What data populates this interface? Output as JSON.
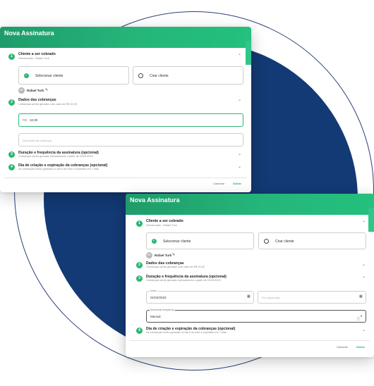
{
  "modal1": {
    "title": "Nova Assinatura",
    "step1": {
      "num": "1",
      "title": "Cliente a ser cobrado",
      "subtitle": "Selecionado - Rafael Turk",
      "select_label": "Selecionar cliente",
      "create_label": "Criar cliente",
      "avatar_initials": "RT",
      "user_name": "Rafael Turk"
    },
    "step2": {
      "num": "2",
      "title": "Dados das cobranças",
      "subtitle": "Cobranças serão geradas com valor de R$ 10,00",
      "value_prefix": "R$",
      "value": "10,00",
      "description_placeholder": "Descrição da cobrança"
    },
    "step3": {
      "num": "3",
      "title": "Duração e frequência da assinatura (opcional)",
      "subtitle": "Cobranças serão geradas mensalmente a partir de 01/02/2023"
    },
    "step4": {
      "num": "4",
      "title": "Dia de criação e expiração da cobranças (opcional)",
      "subtitle": "As cobranças serão geradas no dia 6 do mês e expirarão em 7 dias"
    },
    "cancel_label": "Cancelar",
    "save_label": "Salvar"
  },
  "modal2": {
    "title": "Nova Assinatura",
    "step1": {
      "num": "1",
      "title": "Cliente a ser cobrado",
      "subtitle": "Selecionado - Rafael Turk",
      "select_label": "Selecionar cliente",
      "create_label": "Criar cliente",
      "avatar_initials": "RT",
      "user_name": "Rafael Turk"
    },
    "step2": {
      "num": "2",
      "title": "Dados das cobranças",
      "subtitle": "Cobranças serão geradas com valor de R$ 10,00"
    },
    "step3": {
      "num": "3",
      "title": "Duração e frequência da assinatura (opcional)",
      "subtitle": "Cobranças serão geradas mensalmente a partir de 01/02/2023",
      "start_label": "Início",
      "start_value": "01/02/2023",
      "end_placeholder": "Fim (opcional)",
      "frequency_label": "Selecionar frequência",
      "frequency_value": "Mensal"
    },
    "step4": {
      "num": "4",
      "title": "Dia de criação e expiração da cobranças (opcional)",
      "subtitle": "As cobranças serão geradas no dia 6 do mês e expirarão em 7 dias"
    },
    "cancel_label": "Cancelar",
    "save_label": "Salvar"
  },
  "colors": {
    "brand_green": "#2bb673",
    "navy": "#133a75"
  }
}
